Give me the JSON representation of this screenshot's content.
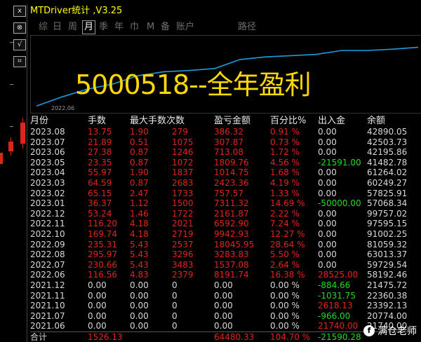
{
  "window": {
    "title": "MTDriver统计 ,V3.25"
  },
  "side_buttons": [
    "x",
    "⊗",
    "√",
    "⌗"
  ],
  "tabs": [
    "综",
    "日",
    "周",
    "月",
    "季",
    "年",
    "巾",
    "M",
    "备",
    "账户",
    "路径"
  ],
  "active_tab": "月",
  "headline": "5000518--全年盈利",
  "chart_data": {
    "type": "line",
    "x_start_label": "2022.06",
    "values": [
      0.02,
      0.16,
      0.28,
      0.36,
      0.49,
      0.55,
      0.57,
      0.6,
      0.74,
      0.78,
      0.8,
      0.82,
      0.88,
      0.88,
      0.9,
      0.93
    ],
    "color": "#1e9be0"
  },
  "table": {
    "headers": [
      "月份",
      "手数",
      "最大手数",
      "次数",
      "盈亏金额",
      "百分比%",
      "出入金",
      "余额"
    ],
    "rows": [
      {
        "month": "2023.08",
        "hands": "13.75",
        "max": "1.90",
        "count": "279",
        "pl": "386.32",
        "pct": "0.91 %",
        "io": "0.00",
        "bal": "42890.05",
        "pl_color": "red",
        "io_color": "white"
      },
      {
        "month": "2023.07",
        "hands": "21.89",
        "max": "0.51",
        "count": "1075",
        "pl": "307.87",
        "pct": "0.73 %",
        "io": "0.00",
        "bal": "42503.73",
        "pl_color": "red",
        "io_color": "white"
      },
      {
        "month": "2023.06",
        "hands": "27.38",
        "max": "0.87",
        "count": "1246",
        "pl": "713.08",
        "pct": "1.72 %",
        "io": "0.00",
        "bal": "42195.86",
        "pl_color": "red",
        "io_color": "white"
      },
      {
        "month": "2023.05",
        "hands": "23.35",
        "max": "0.87",
        "count": "1072",
        "pl": "1809.76",
        "pct": "4.56 %",
        "io": "-21591.00",
        "bal": "41482.78",
        "pl_color": "red",
        "io_color": "green"
      },
      {
        "month": "2023.04",
        "hands": "55.97",
        "max": "1.90",
        "count": "1837",
        "pl": "1014.75",
        "pct": "1.68 %",
        "io": "0.00",
        "bal": "61264.02",
        "pl_color": "red",
        "io_color": "white"
      },
      {
        "month": "2023.03",
        "hands": "64.59",
        "max": "0.87",
        "count": "2683",
        "pl": "2423.36",
        "pct": "4.19 %",
        "io": "0.00",
        "bal": "60249.27",
        "pl_color": "red",
        "io_color": "white"
      },
      {
        "month": "2023.02",
        "hands": "65.15",
        "max": "2.47",
        "count": "1733",
        "pl": "757.57",
        "pct": "1.33 %",
        "io": "0.00",
        "bal": "57825.91",
        "pl_color": "red",
        "io_color": "white"
      },
      {
        "month": "2023.01",
        "hands": "36.37",
        "max": "1.12",
        "count": "1500",
        "pl": "7311.32",
        "pct": "14.69 %",
        "io": "-50000.00",
        "bal": "57068.34",
        "pl_color": "red",
        "io_color": "green"
      },
      {
        "month": "2022.12",
        "hands": "53.24",
        "max": "1.46",
        "count": "1722",
        "pl": "2161.87",
        "pct": "2.22 %",
        "io": "0.00",
        "bal": "99757.02",
        "pl_color": "red",
        "io_color": "white"
      },
      {
        "month": "2022.11",
        "hands": "116.20",
        "max": "4.18",
        "count": "2021",
        "pl": "6592.90",
        "pct": "7.24 %",
        "io": "0.00",
        "bal": "97595.15",
        "pl_color": "red",
        "io_color": "white"
      },
      {
        "month": "2022.10",
        "hands": "169.74",
        "max": "4.18",
        "count": "2719",
        "pl": "9942.93",
        "pct": "12.27 %",
        "io": "0.00",
        "bal": "91002.25",
        "pl_color": "red",
        "io_color": "white"
      },
      {
        "month": "2022.09",
        "hands": "235.31",
        "max": "5.43",
        "count": "2537",
        "pl": "18045.95",
        "pct": "28.64 %",
        "io": "0.00",
        "bal": "81059.32",
        "pl_color": "red",
        "io_color": "white"
      },
      {
        "month": "2022.08",
        "hands": "295.97",
        "max": "5.43",
        "count": "3296",
        "pl": "3283.83",
        "pct": "5.50 %",
        "io": "0.00",
        "bal": "63013.37",
        "pl_color": "red",
        "io_color": "white"
      },
      {
        "month": "2022.07",
        "hands": "230.66",
        "max": "5.43",
        "count": "3483",
        "pl": "1537.08",
        "pct": "2.64 %",
        "io": "0.00",
        "bal": "59729.54",
        "pl_color": "red",
        "io_color": "white"
      },
      {
        "month": "2022.06",
        "hands": "116.56",
        "max": "4.83",
        "count": "2379",
        "pl": "8191.74",
        "pct": "16.38 %",
        "io": "28525.00",
        "bal": "58192.46",
        "pl_color": "red",
        "io_color": "red"
      },
      {
        "month": "2021.12",
        "hands": "0.00",
        "max": "0.00",
        "count": "0",
        "pl": "0.00",
        "pct": "0.00 %",
        "io": "-884.66",
        "bal": "21475.72",
        "pl_color": "white",
        "io_color": "green"
      },
      {
        "month": "2021.11",
        "hands": "0.00",
        "max": "0.00",
        "count": "0",
        "pl": "0.00",
        "pct": "0.00 %",
        "io": "-1031.75",
        "bal": "22360.38",
        "pl_color": "white",
        "io_color": "green"
      },
      {
        "month": "2021.10",
        "hands": "0.00",
        "max": "0.00",
        "count": "0",
        "pl": "0.00",
        "pct": "0.00 %",
        "io": "2618.13",
        "bal": "23392.13",
        "pl_color": "white",
        "io_color": "red"
      },
      {
        "month": "2021.07",
        "hands": "0.00",
        "max": "0.00",
        "count": "0",
        "pl": "0.00",
        "pct": "0.00 %",
        "io": "-966.00",
        "bal": "20774.00",
        "pl_color": "white",
        "io_color": "green"
      },
      {
        "month": "2021.06",
        "hands": "0.00",
        "max": "0.00",
        "count": "0",
        "pl": "0.00",
        "pct": "0.00 %",
        "io": "21740.00",
        "bal": "21740.00",
        "pl_color": "white",
        "io_color": "red"
      }
    ],
    "total": {
      "label": "合计",
      "hands": "1526.13",
      "max": "",
      "count": "",
      "pl": "64480.33",
      "pct": "104.70 %",
      "io": "-21590.28",
      "bal": ""
    }
  },
  "watermark": {
    "logo": "f",
    "text": "满仓老师"
  },
  "colors": {
    "positive": "#e0241b",
    "negative": "#22d822",
    "title": "#ffff00",
    "headline": "#ffd800"
  }
}
